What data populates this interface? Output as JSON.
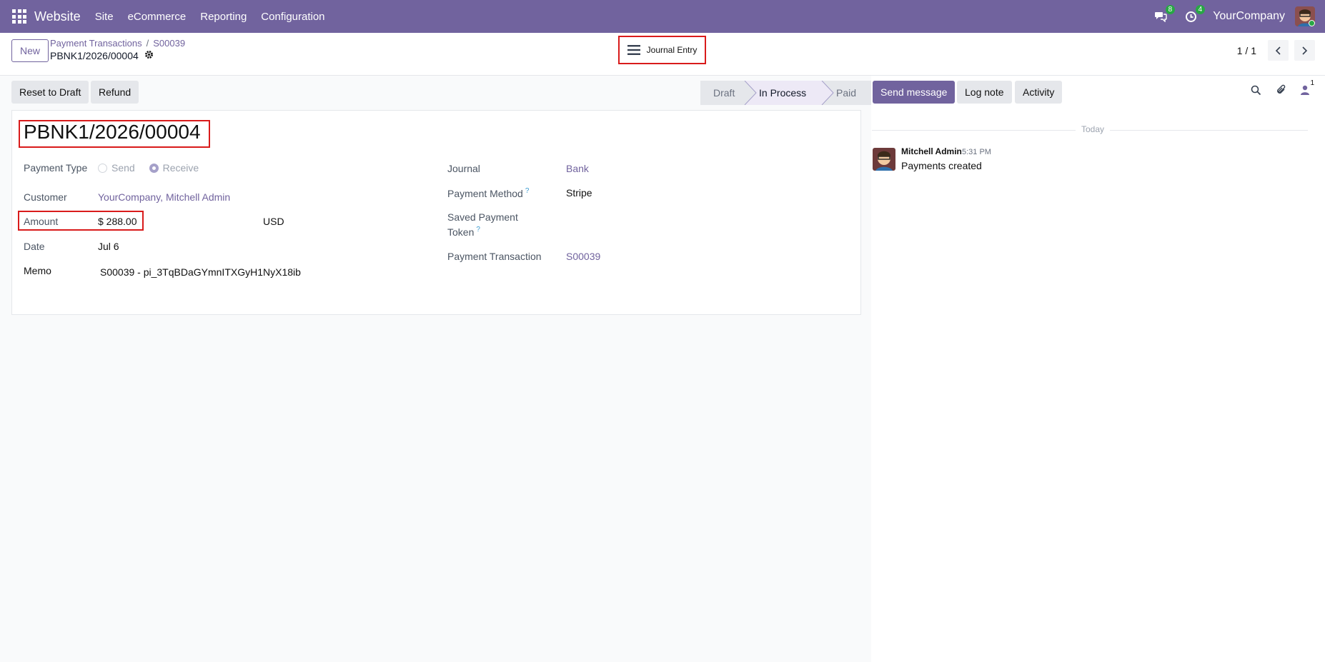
{
  "navbar": {
    "app_name": "Website",
    "menu": [
      "Site",
      "eCommerce",
      "Reporting",
      "Configuration"
    ],
    "messages_badge": "8",
    "activities_badge": "4",
    "company": "YourCompany"
  },
  "control": {
    "new_label": "New",
    "breadcrumb": [
      "Payment Transactions",
      "S00039"
    ],
    "record_name": "PBNK1/2026/00004",
    "smart_button": "Journal Entry",
    "pager": "1 / 1"
  },
  "actions": {
    "reset": "Reset to Draft",
    "refund": "Refund"
  },
  "status": [
    "Draft",
    "In Process",
    "Paid"
  ],
  "form": {
    "title": "PBNK1/2026/00004",
    "payment_type_label": "Payment Type",
    "payment_type_options": [
      "Send",
      "Receive"
    ],
    "customer_label": "Customer",
    "customer": "YourCompany, Mitchell Admin",
    "amount_label": "Amount",
    "amount": "$ 288.00",
    "currency": "USD",
    "date_label": "Date",
    "date": "Jul 6",
    "memo_label": "Memo",
    "memo": "S00039 - pi_3TqBDaGYmnITXGyH1NyX18ib",
    "journal_label": "Journal",
    "journal": "Bank",
    "payment_method_label": "Payment Method",
    "payment_method": "Stripe",
    "saved_token_label_1": "Saved Payment",
    "saved_token_label_2": "Token",
    "payment_transaction_label": "Payment Transaction",
    "payment_transaction": "S00039"
  },
  "chatter": {
    "send_message": "Send message",
    "log_note": "Log note",
    "activity": "Activity",
    "followers_count": "1",
    "today": "Today",
    "author": "Mitchell Admin",
    "time": "5:31 PM",
    "body": "Payments created"
  }
}
